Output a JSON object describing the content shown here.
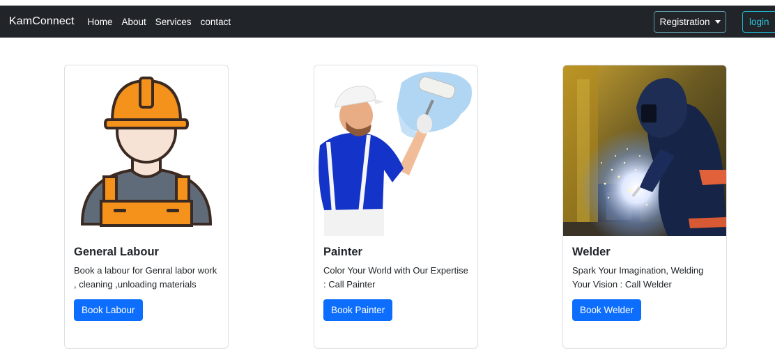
{
  "navbar": {
    "brand": "KamConnect",
    "links": [
      "Home",
      "About",
      "Services",
      "contact"
    ],
    "registration_label": "Registration",
    "login_label": "login"
  },
  "cards": [
    {
      "title": "General Labour",
      "text": "Book a labour for Genral labor work , cleaning ,unloading materials",
      "button": "Book Labour",
      "image": "labourer-icon"
    },
    {
      "title": "Painter",
      "text": "Color Your World with Our Expertise : Call Painter",
      "button": "Book Painter",
      "image": "painter-photo"
    },
    {
      "title": "Welder",
      "text": "Spark Your Imagination, Welding Your Vision : Call Welder",
      "button": "Book Welder",
      "image": "welder-photo"
    }
  ],
  "colors": {
    "navbar_bg": "#212529",
    "primary": "#0d6efd",
    "login_accent": "#2fc6dd"
  }
}
